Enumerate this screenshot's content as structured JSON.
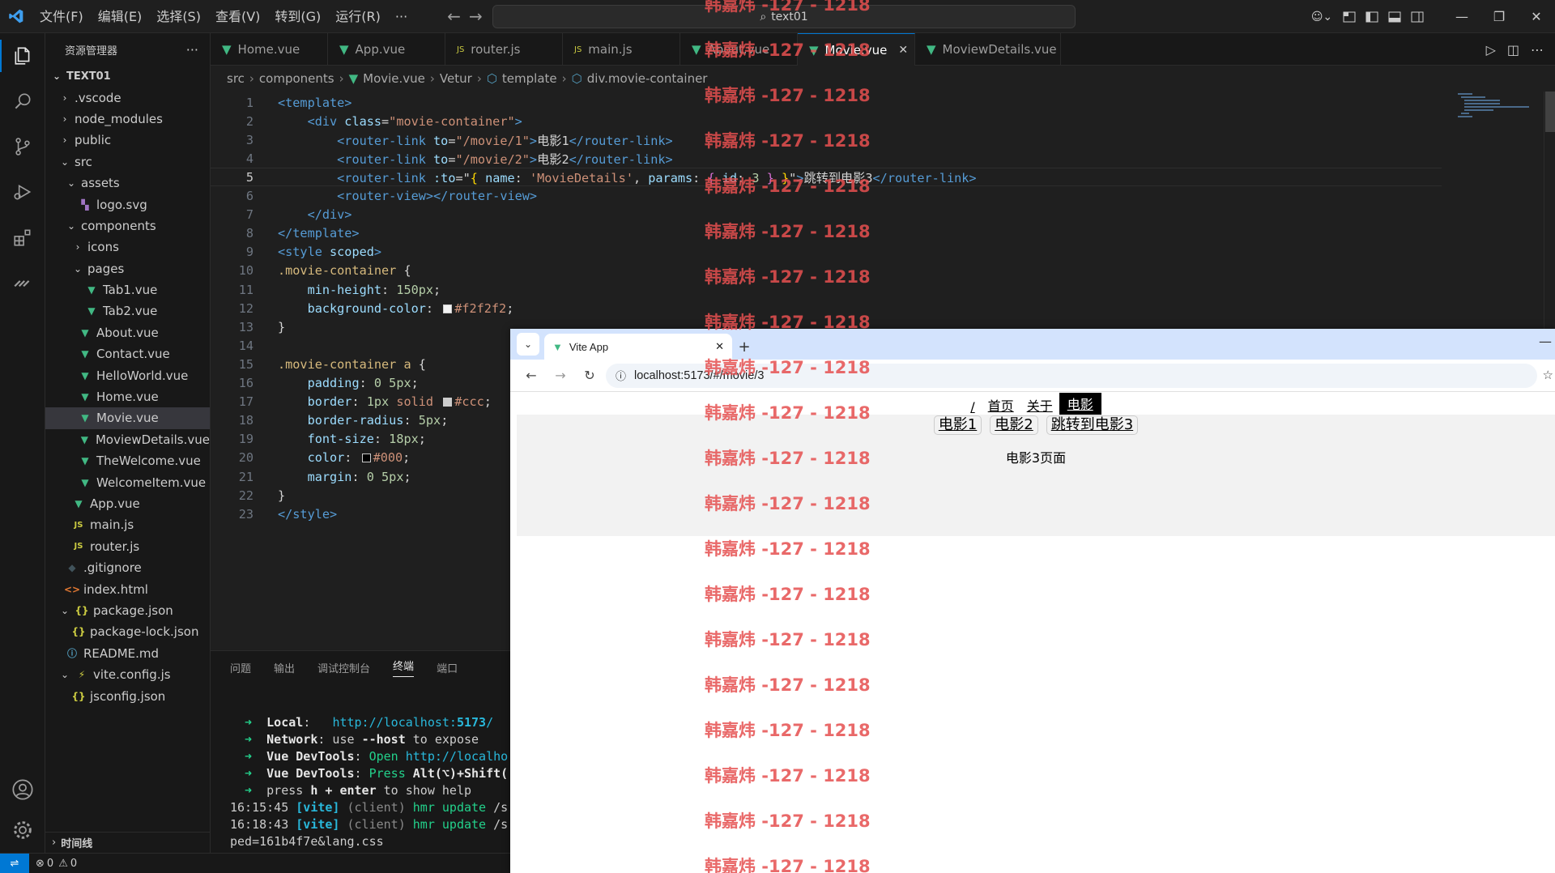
{
  "titlebar": {
    "menus": [
      "文件(F)",
      "编辑(E)",
      "选择(S)",
      "查看(V)",
      "转到(G)",
      "运行(R)",
      "···"
    ],
    "search_text": "text01"
  },
  "sidebar": {
    "title": "资源管理器",
    "more": "···",
    "root": "TEXT01",
    "items": [
      {
        "label": ".vscode",
        "indent": 1,
        "chevron": ">",
        "icon": ""
      },
      {
        "label": "node_modules",
        "indent": 1,
        "chevron": ">",
        "icon": ""
      },
      {
        "label": "public",
        "indent": 1,
        "chevron": ">",
        "icon": ""
      },
      {
        "label": "src",
        "indent": 1,
        "chevron": "v",
        "icon": ""
      },
      {
        "label": "assets",
        "indent": 2,
        "chevron": "v",
        "icon": ""
      },
      {
        "label": "logo.svg",
        "indent": 3,
        "chevron": "",
        "icon": "svg"
      },
      {
        "label": "components",
        "indent": 2,
        "chevron": "v",
        "icon": ""
      },
      {
        "label": "icons",
        "indent": 3,
        "chevron": ">",
        "icon": ""
      },
      {
        "label": "pages",
        "indent": 3,
        "chevron": "v",
        "icon": ""
      },
      {
        "label": "Tab1.vue",
        "indent": 4,
        "chevron": "",
        "icon": "vue"
      },
      {
        "label": "Tab2.vue",
        "indent": 4,
        "chevron": "",
        "icon": "vue"
      },
      {
        "label": "About.vue",
        "indent": 3,
        "chevron": "",
        "icon": "vue"
      },
      {
        "label": "Contact.vue",
        "indent": 3,
        "chevron": "",
        "icon": "vue"
      },
      {
        "label": "HelloWorld.vue",
        "indent": 3,
        "chevron": "",
        "icon": "vue"
      },
      {
        "label": "Home.vue",
        "indent": 3,
        "chevron": "",
        "icon": "vue"
      },
      {
        "label": "Movie.vue",
        "indent": 3,
        "chevron": "",
        "icon": "vue",
        "selected": true
      },
      {
        "label": "MoviewDetails.vue",
        "indent": 3,
        "chevron": "",
        "icon": "vue"
      },
      {
        "label": "TheWelcome.vue",
        "indent": 3,
        "chevron": "",
        "icon": "vue"
      },
      {
        "label": "WelcomeItem.vue",
        "indent": 3,
        "chevron": "",
        "icon": "vue"
      },
      {
        "label": "App.vue",
        "indent": 2,
        "chevron": "",
        "icon": "vue"
      },
      {
        "label": "main.js",
        "indent": 2,
        "chevron": "",
        "icon": "js"
      },
      {
        "label": "router.js",
        "indent": 2,
        "chevron": "",
        "icon": "js"
      },
      {
        "label": ".gitignore",
        "indent": 1,
        "chevron": "",
        "icon": "git"
      },
      {
        "label": "index.html",
        "indent": 1,
        "chevron": "",
        "icon": "html"
      },
      {
        "label": "package.json",
        "indent": 1,
        "chevron": "v",
        "icon": "json"
      },
      {
        "label": "package-lock.json",
        "indent": 2,
        "chevron": "",
        "icon": "json"
      },
      {
        "label": "README.md",
        "indent": 1,
        "chevron": "",
        "icon": "info"
      },
      {
        "label": "vite.config.js",
        "indent": 1,
        "chevron": "v",
        "icon": "vite"
      },
      {
        "label": "jsconfig.json",
        "indent": 2,
        "chevron": "",
        "icon": "json"
      }
    ],
    "timeline": "时间线"
  },
  "tabs": [
    {
      "label": "Home.vue",
      "icon": "vue"
    },
    {
      "label": "App.vue",
      "icon": "vue"
    },
    {
      "label": "router.js",
      "icon": "js"
    },
    {
      "label": "main.js",
      "icon": "js"
    },
    {
      "label": "About.vue",
      "icon": "vue"
    },
    {
      "label": "Movie.vue",
      "icon": "vue",
      "active": true
    },
    {
      "label": "MoviewDetails.vue",
      "icon": "vue"
    }
  ],
  "breadcrumb": [
    "src",
    "components",
    "Movie.vue",
    "Vetur",
    "template",
    "div.movie-container"
  ],
  "code": {
    "line_numbers": [
      "1",
      "2",
      "3",
      "4",
      "5",
      "6",
      "7",
      "8",
      "9",
      "10",
      "11",
      "12",
      "13",
      "14",
      "15",
      "16",
      "17",
      "18",
      "19",
      "20",
      "21",
      "22",
      "23"
    ],
    "current_line": 5,
    "lines": [
      [
        [
          "t-tag",
          "<template>"
        ]
      ],
      [
        [
          "t-txt",
          "    "
        ],
        [
          "t-tag",
          "<div "
        ],
        [
          "t-attr",
          "class"
        ],
        [
          "t-txt",
          "="
        ],
        [
          "t-str",
          "\"movie-container\""
        ],
        [
          "t-tag",
          ">"
        ]
      ],
      [
        [
          "t-txt",
          "        "
        ],
        [
          "t-tag",
          "<router-link "
        ],
        [
          "t-attr",
          "to"
        ],
        [
          "t-txt",
          "="
        ],
        [
          "t-str",
          "\"/movie/1\""
        ],
        [
          "t-tag",
          ">"
        ],
        [
          "t-txt",
          "电影1"
        ],
        [
          "t-tag",
          "</router-link>"
        ]
      ],
      [
        [
          "t-txt",
          "        "
        ],
        [
          "t-tag",
          "<router-link "
        ],
        [
          "t-attr",
          "to"
        ],
        [
          "t-txt",
          "="
        ],
        [
          "t-str",
          "\"/movie/2\""
        ],
        [
          "t-tag",
          ">"
        ],
        [
          "t-txt",
          "电影2"
        ],
        [
          "t-tag",
          "</router-link>"
        ]
      ],
      [
        [
          "t-txt",
          "        "
        ],
        [
          "t-tag",
          "<router-link "
        ],
        [
          "t-attr",
          ":to"
        ],
        [
          "t-txt",
          "=\""
        ],
        [
          "t-brk",
          "{"
        ],
        [
          "t-txt",
          " "
        ],
        [
          "t-attr",
          "name"
        ],
        [
          "t-txt",
          ": "
        ],
        [
          "t-str",
          "'MovieDetails'"
        ],
        [
          "t-txt",
          ", "
        ],
        [
          "t-attr",
          "params"
        ],
        [
          "t-txt",
          ": "
        ],
        [
          "t-brk2",
          "{"
        ],
        [
          "t-txt",
          " "
        ],
        [
          "t-attr",
          "id"
        ],
        [
          "t-txt",
          ": "
        ],
        [
          "t-num",
          "3"
        ],
        [
          "t-txt",
          " "
        ],
        [
          "t-brk2",
          "}"
        ],
        [
          "t-txt",
          " "
        ],
        [
          "t-brk",
          "}"
        ],
        [
          "t-txt",
          "\""
        ],
        [
          "t-tag",
          ">"
        ],
        [
          "t-txt",
          "跳转到电影3"
        ],
        [
          "t-tag",
          "</router-link>"
        ]
      ],
      [
        [
          "t-txt",
          "        "
        ],
        [
          "t-tag",
          "<router-view></router-view>"
        ]
      ],
      [
        [
          "t-txt",
          "    "
        ],
        [
          "t-tag",
          "</div>"
        ]
      ],
      [
        [
          "t-tag",
          "</template>"
        ]
      ],
      [
        [
          "t-tag",
          "<style "
        ],
        [
          "t-attr",
          "scoped"
        ],
        [
          "t-tag",
          ">"
        ]
      ],
      [
        [
          "t-sel",
          ".movie-container"
        ],
        [
          "t-txt",
          " {"
        ]
      ],
      [
        [
          "t-txt",
          "    "
        ],
        [
          "t-attr",
          "min-height"
        ],
        [
          "t-txt",
          ": "
        ],
        [
          "t-num",
          "150px"
        ],
        [
          "t-txt",
          ";"
        ]
      ],
      [
        [
          "t-txt",
          "    "
        ],
        [
          "t-attr",
          "background-color"
        ],
        [
          "t-txt",
          ": "
        ],
        [
          "swatch",
          "#f2f2f2"
        ],
        [
          "t-kw",
          "#f2f2f2"
        ],
        [
          "t-txt",
          ";"
        ]
      ],
      [
        [
          "t-txt",
          "}"
        ]
      ],
      [],
      [
        [
          "t-sel",
          ".movie-container a"
        ],
        [
          "t-txt",
          " {"
        ]
      ],
      [
        [
          "t-txt",
          "    "
        ],
        [
          "t-attr",
          "padding"
        ],
        [
          "t-txt",
          ": "
        ],
        [
          "t-num",
          "0 5px"
        ],
        [
          "t-txt",
          ";"
        ]
      ],
      [
        [
          "t-txt",
          "    "
        ],
        [
          "t-attr",
          "border"
        ],
        [
          "t-txt",
          ": "
        ],
        [
          "t-num",
          "1px"
        ],
        [
          "t-txt",
          " "
        ],
        [
          "t-kw",
          "solid"
        ],
        [
          "t-txt",
          " "
        ],
        [
          "swatch",
          "#cccccc"
        ],
        [
          "t-kw",
          "#ccc"
        ],
        [
          "t-txt",
          ";"
        ]
      ],
      [
        [
          "t-txt",
          "    "
        ],
        [
          "t-attr",
          "border-radius"
        ],
        [
          "t-txt",
          ": "
        ],
        [
          "t-num",
          "5px"
        ],
        [
          "t-txt",
          ";"
        ]
      ],
      [
        [
          "t-txt",
          "    "
        ],
        [
          "t-attr",
          "font-size"
        ],
        [
          "t-txt",
          ": "
        ],
        [
          "t-num",
          "18px"
        ],
        [
          "t-txt",
          ";"
        ]
      ],
      [
        [
          "t-txt",
          "    "
        ],
        [
          "t-attr",
          "color"
        ],
        [
          "t-txt",
          ": "
        ],
        [
          "swatch",
          "#000000"
        ],
        [
          "t-kw",
          "#000"
        ],
        [
          "t-txt",
          ";"
        ]
      ],
      [
        [
          "t-txt",
          "    "
        ],
        [
          "t-attr",
          "margin"
        ],
        [
          "t-txt",
          ": "
        ],
        [
          "t-num",
          "0 5px"
        ],
        [
          "t-txt",
          ";"
        ]
      ],
      [
        [
          "t-txt",
          "}"
        ]
      ],
      [
        [
          "t-tag",
          "</style>"
        ]
      ]
    ]
  },
  "panel": {
    "tabs": [
      "问题",
      "输出",
      "调试控制台",
      "终端",
      "端口"
    ],
    "active_tab": "终端",
    "terminal": [
      [
        [
          "ar",
          "  ➜  "
        ],
        [
          "b",
          "Local"
        ],
        [
          "t",
          ":   "
        ],
        [
          "url",
          "http://localhost:"
        ],
        [
          "url b",
          "5173"
        ],
        [
          "url",
          "/"
        ]
      ],
      [
        [
          "ar",
          "  ➜  "
        ],
        [
          "b",
          "Network"
        ],
        [
          "t",
          ": use "
        ],
        [
          "b",
          "--host"
        ],
        [
          "t",
          " to expose"
        ]
      ],
      [
        [
          "ar",
          "  ➜  "
        ],
        [
          "b",
          "Vue DevTools"
        ],
        [
          "t",
          ": "
        ],
        [
          "gr",
          "Open "
        ],
        [
          "url",
          "http://localho"
        ]
      ],
      [
        [
          "ar",
          "  ➜  "
        ],
        [
          "b",
          "Vue DevTools"
        ],
        [
          "t",
          ": "
        ],
        [
          "gr",
          "Press "
        ],
        [
          "b",
          "Alt(⌥)+Shift("
        ]
      ],
      [
        [
          "ar",
          "  ➜  "
        ],
        [
          "t",
          "press "
        ],
        [
          "b",
          "h + enter"
        ],
        [
          "t",
          " to show help"
        ]
      ],
      [
        [
          "t",
          "16:15:45 "
        ],
        [
          "cy b",
          "[vite]"
        ],
        [
          "dim",
          " (client)"
        ],
        [
          "gr",
          " hmr update "
        ],
        [
          "t",
          "/s"
        ]
      ],
      [
        [
          "t",
          "16:18:43 "
        ],
        [
          "cy b",
          "[vite]"
        ],
        [
          "dim",
          " (client)"
        ],
        [
          "gr",
          " hmr update "
        ],
        [
          "t",
          "/s"
        ]
      ],
      [
        [
          "t",
          "ped=161b4f7e&lang.css"
        ]
      ]
    ]
  },
  "statusbar": {
    "errors": "0",
    "warnings": "0"
  },
  "browser": {
    "tab_title": "Vite App",
    "new_tab": "+",
    "url": "localhost:5173/#/movie/3",
    "nav": [
      "/",
      "首页",
      "关于",
      "电影"
    ],
    "nav_active": "电影",
    "movie_links": [
      "电影1",
      "电影2",
      "跳转到电影3"
    ],
    "view_text": "电影3页面"
  },
  "watermark": {
    "text": "韩嘉炜 -127 - 1218",
    "color": "#e65050"
  }
}
